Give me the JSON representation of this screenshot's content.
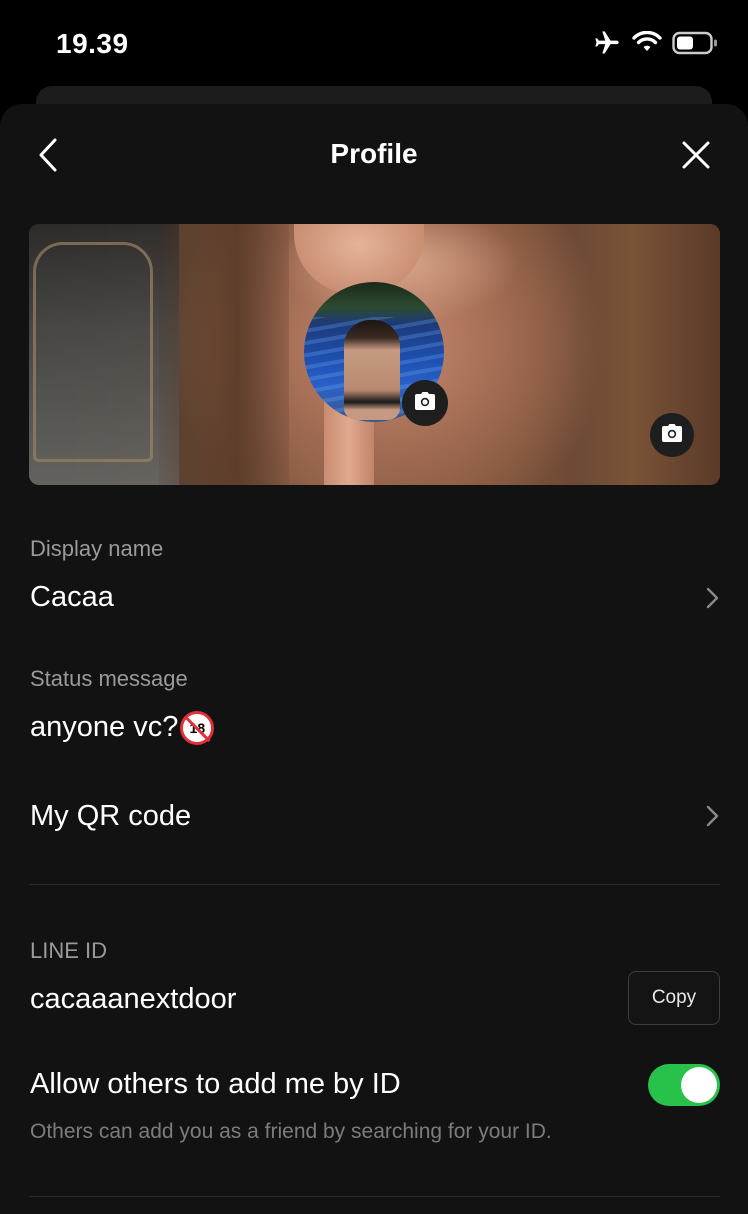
{
  "status_bar": {
    "time": "19.39",
    "icons": [
      "airplane-icon",
      "wifi-icon",
      "battery-icon"
    ]
  },
  "header": {
    "title": "Profile",
    "back_icon": "chevron-left-icon",
    "close_icon": "close-icon"
  },
  "profile": {
    "display_name_label": "Display name",
    "display_name": "Cacaa",
    "status_label": "Status message",
    "status_message": "anyone vc?",
    "status_emoji": "18",
    "qr_label": "My QR code",
    "line_id_label": "LINE ID",
    "line_id": "cacaaanextdoor",
    "copy_label": "Copy",
    "allow_add_label": "Allow others to add me by ID",
    "allow_add_enabled": true,
    "allow_add_helper": "Others can add you as a friend by searching for your ID."
  },
  "colors": {
    "background": "#121212",
    "toggle_on": "#28c24b",
    "label_gray": "#9a9a9a"
  }
}
